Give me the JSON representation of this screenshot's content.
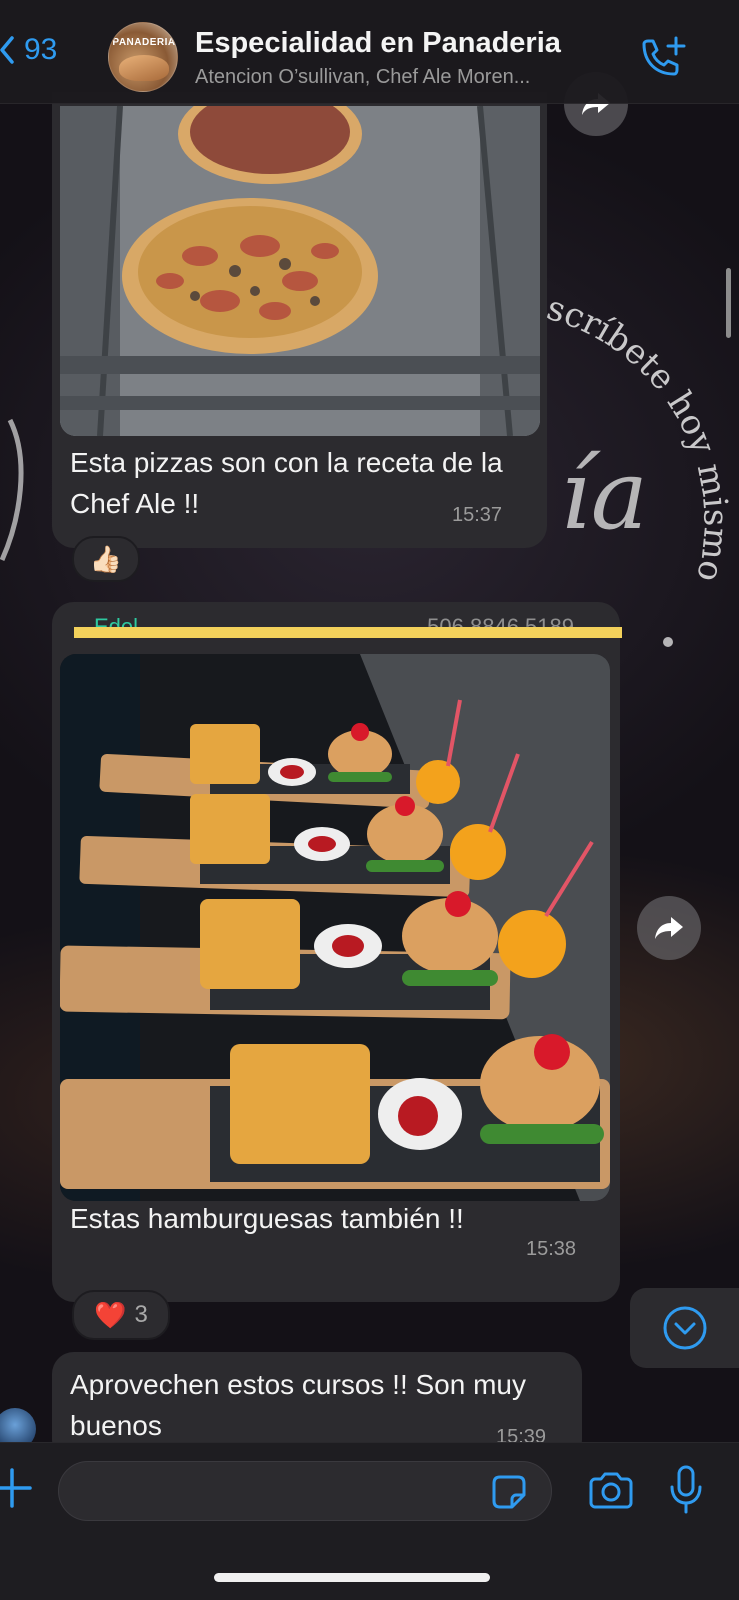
{
  "header": {
    "back_count": "93",
    "title": "Especialidad en Panaderia",
    "subtitle": "Atencion O’sullivan, Chef Ale Moren...",
    "avatar_text": "PANADERIA"
  },
  "wallpaper": {
    "curved_text": "scríbete hoy mismo",
    "script_text": "ía"
  },
  "messages": [
    {
      "text": "Esta pizzas son con la receta de la Chef Ale !!",
      "time": "15:37",
      "reaction": {
        "emoji": "👍🏻",
        "count": ""
      }
    },
    {
      "sender": "Edel",
      "sender_phone": "506 8846 5189",
      "text": "Estas hamburguesas también !!",
      "time": "15:38",
      "reaction": {
        "emoji": "❤️",
        "count": "3"
      }
    },
    {
      "text": "Aprovechen estos cursos !! Son muy buenos",
      "time": "15:39"
    }
  ],
  "composer": {
    "placeholder": ""
  },
  "colors": {
    "accent": "#2f9bf0",
    "bubble": "#2c2b2f",
    "sender_name": "#2ec9a0",
    "redaction": "#f3d15b"
  },
  "icons": [
    "chevron-left-icon",
    "add-call-icon",
    "forward-icon",
    "chevron-down-icon",
    "plus-icon",
    "sticker-icon",
    "camera-icon",
    "microphone-icon"
  ]
}
